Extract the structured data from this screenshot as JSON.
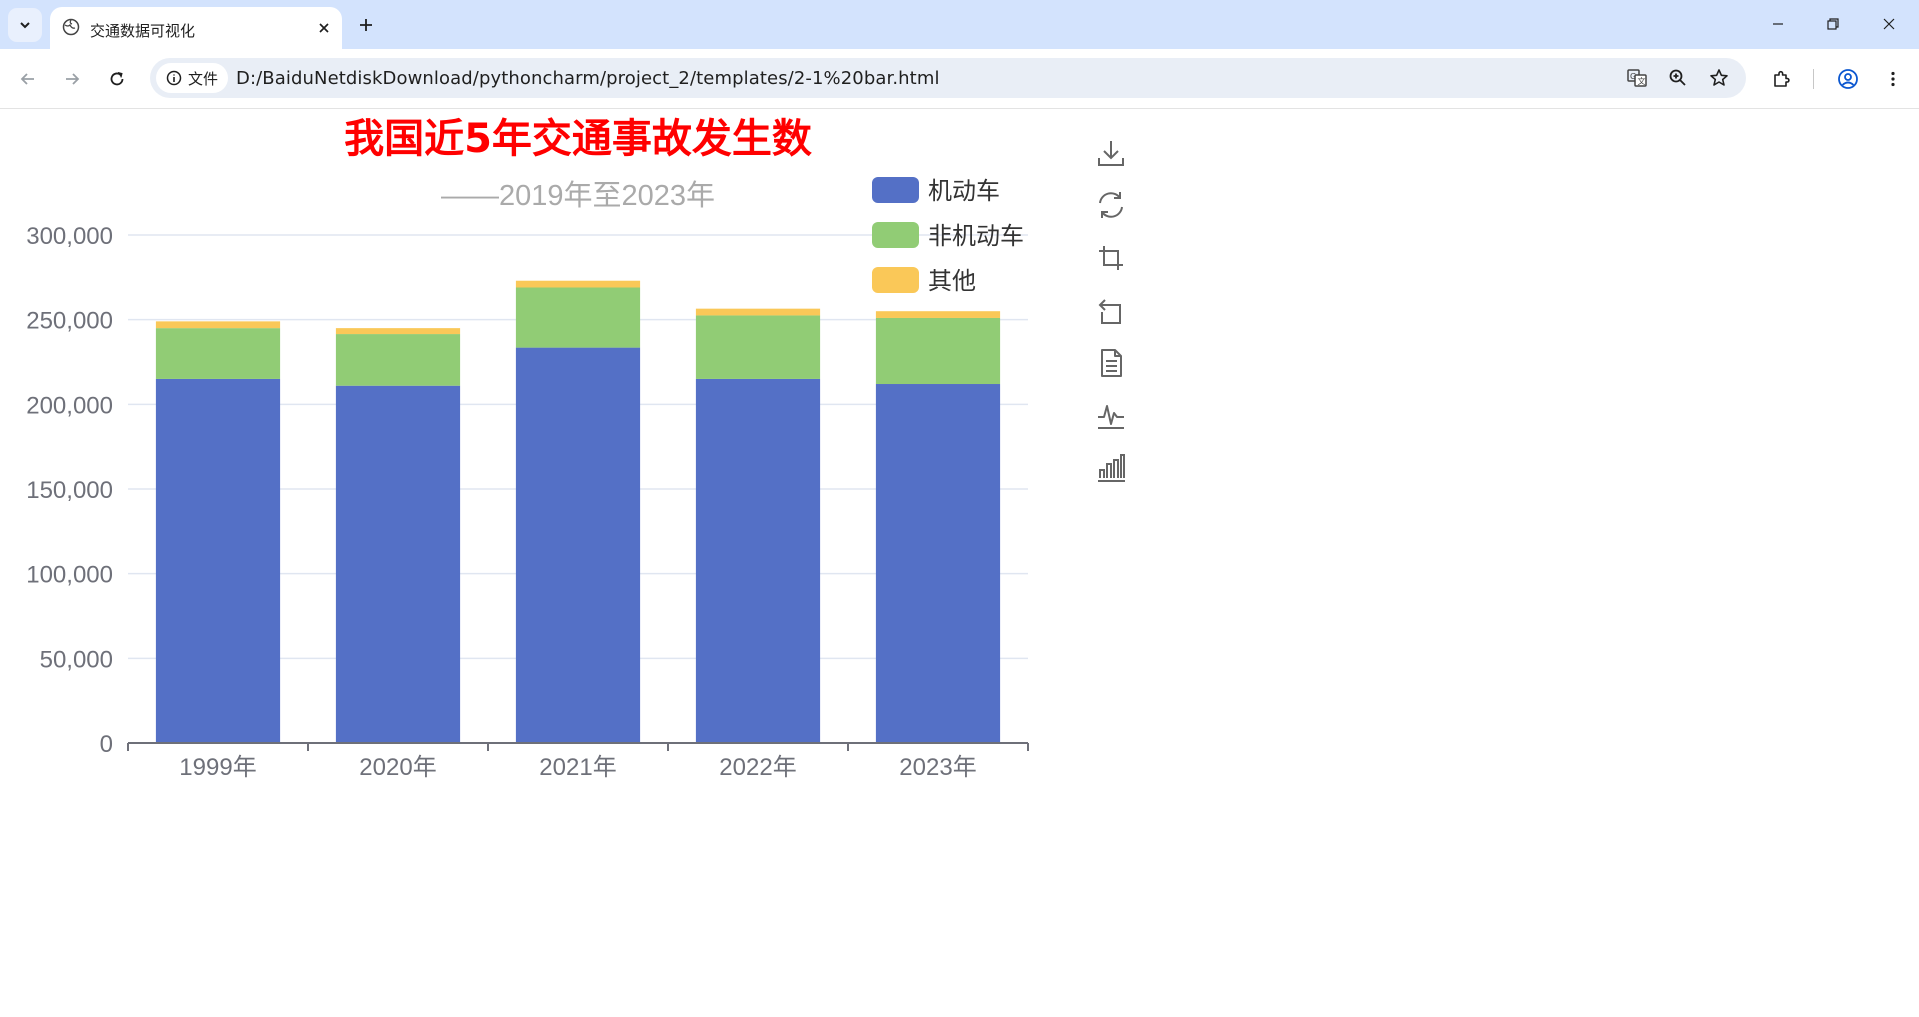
{
  "browser": {
    "tab_title": "交通数据可视化",
    "site_info_label": "文件",
    "url": "D:/BaiduNetdiskDownload/pythoncharm/project_2/templates/2-1%20bar.html"
  },
  "colors": {
    "title": "#ff0000",
    "subtitle": "#aaaaaa",
    "series": [
      "#5470c6",
      "#91cc75",
      "#fac858"
    ],
    "axis_text": "#6e7079",
    "grid": "#e0e6f1"
  },
  "toolbox": {
    "icons": [
      "download-icon",
      "refresh-icon",
      "zoom-area-icon",
      "zoom-reset-icon",
      "data-view-icon",
      "line-chart-icon",
      "bar-chart-icon"
    ]
  },
  "chart_data": {
    "type": "bar",
    "stacked": true,
    "title": "我国近5年交通事故发生数",
    "subtitle": "——2019年至2023年",
    "categories": [
      "1999年",
      "2020年",
      "2021年",
      "2022年",
      "2023年"
    ],
    "series": [
      {
        "name": "机动车",
        "values": [
          215000,
          211000,
          233500,
          215000,
          212000
        ]
      },
      {
        "name": "非机动车",
        "values": [
          30000,
          30500,
          35500,
          37500,
          39000
        ]
      },
      {
        "name": "其他",
        "values": [
          4000,
          3500,
          4000,
          4000,
          4000
        ]
      }
    ],
    "ylim": [
      0,
      300000
    ],
    "yticks": [
      "0",
      "50,000",
      "100,000",
      "150,000",
      "200,000",
      "250,000",
      "300,000"
    ],
    "ytick_values": [
      0,
      50000,
      100000,
      150000,
      200000,
      250000,
      300000
    ],
    "grid": true,
    "legend_position": "top-right"
  }
}
